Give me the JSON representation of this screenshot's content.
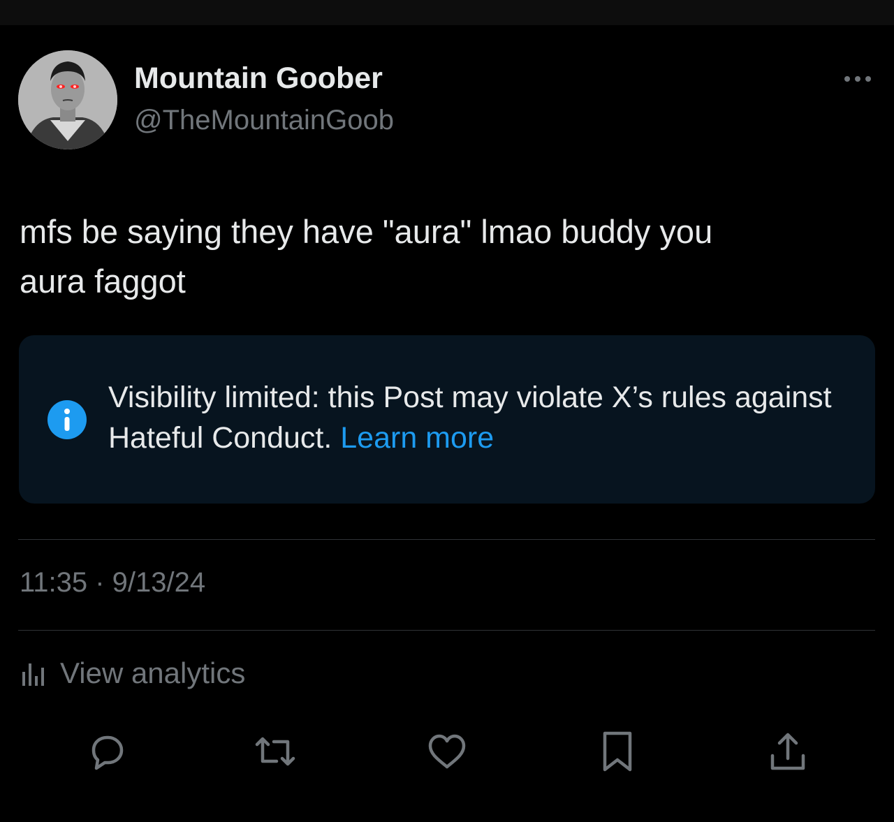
{
  "author": {
    "display_name": "Mountain Goober",
    "handle": "@TheMountainGoob"
  },
  "post": {
    "text_line1": "mfs be saying they have \"aura\" lmao buddy you",
    "text_line2": "aura faggot"
  },
  "notice": {
    "text": "Visibility limited: this Post may violate X’s rules against Hateful Conduct.",
    "link_label": "Learn more",
    "icon": "info-icon"
  },
  "meta": {
    "timestamp": "11:35 · 9/13/24"
  },
  "analytics": {
    "label": "View analytics",
    "icon": "bar-chart-icon"
  },
  "actions": [
    "reply-icon",
    "repost-icon",
    "like-icon",
    "bookmark-icon",
    "share-icon"
  ],
  "colors": {
    "background": "#000000",
    "text": "#e7e9ea",
    "secondary": "#71767b",
    "accent": "#1d9bf0",
    "notice_bg": "#07141f"
  }
}
